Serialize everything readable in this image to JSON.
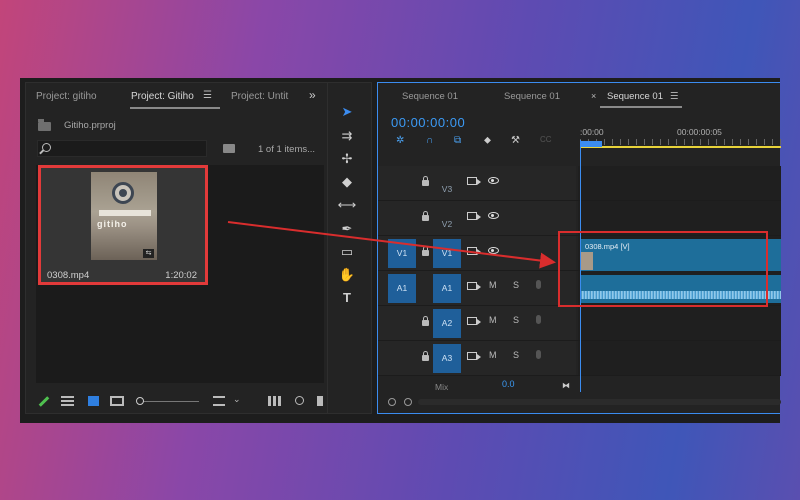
{
  "project_panel": {
    "tabs": [
      {
        "label": "Project: gitiho"
      },
      {
        "label": "Project: Gitiho"
      },
      {
        "label": "Project: Untit"
      }
    ],
    "tab_menu": "☰",
    "overflow": "»",
    "project_file": "Gitiho.prproj",
    "search_placeholder": "",
    "items_count": "1 of 1 items...",
    "clip": {
      "name": "0308.mp4",
      "duration": "1:20:02",
      "thumb_text": "gitiho"
    },
    "highlight_color": "#e23a3a"
  },
  "timeline": {
    "tabs": [
      {
        "label": "Sequence 01"
      },
      {
        "label": "Sequence 01"
      },
      {
        "label": "Sequence 01"
      }
    ],
    "close_glyph": "×",
    "menu_glyph": "☰",
    "timecode": "00:00:00:00",
    "ruler": {
      "start": ":00:00",
      "mark": "00:00:00:05"
    },
    "tracks": [
      {
        "id": "V3",
        "src": "",
        "target": "V3"
      },
      {
        "id": "V2",
        "src": "",
        "target": "V2"
      },
      {
        "id": "V1",
        "src": "V1",
        "target": "V1"
      },
      {
        "id": "A1",
        "src": "A1",
        "target": "A1"
      },
      {
        "id": "A2",
        "src": "",
        "target": "A2"
      },
      {
        "id": "A3",
        "src": "",
        "target": "A3"
      }
    ],
    "buttons": {
      "mute": "M",
      "solo": "S"
    },
    "video_clip_label": "0308.mp4 [V]",
    "mix": {
      "label": "Mix",
      "value": "0.0"
    },
    "accent_color": "#3b9af5",
    "clip_color": "#1e6e9a"
  },
  "annotation": {
    "color": "#d92d2d"
  }
}
